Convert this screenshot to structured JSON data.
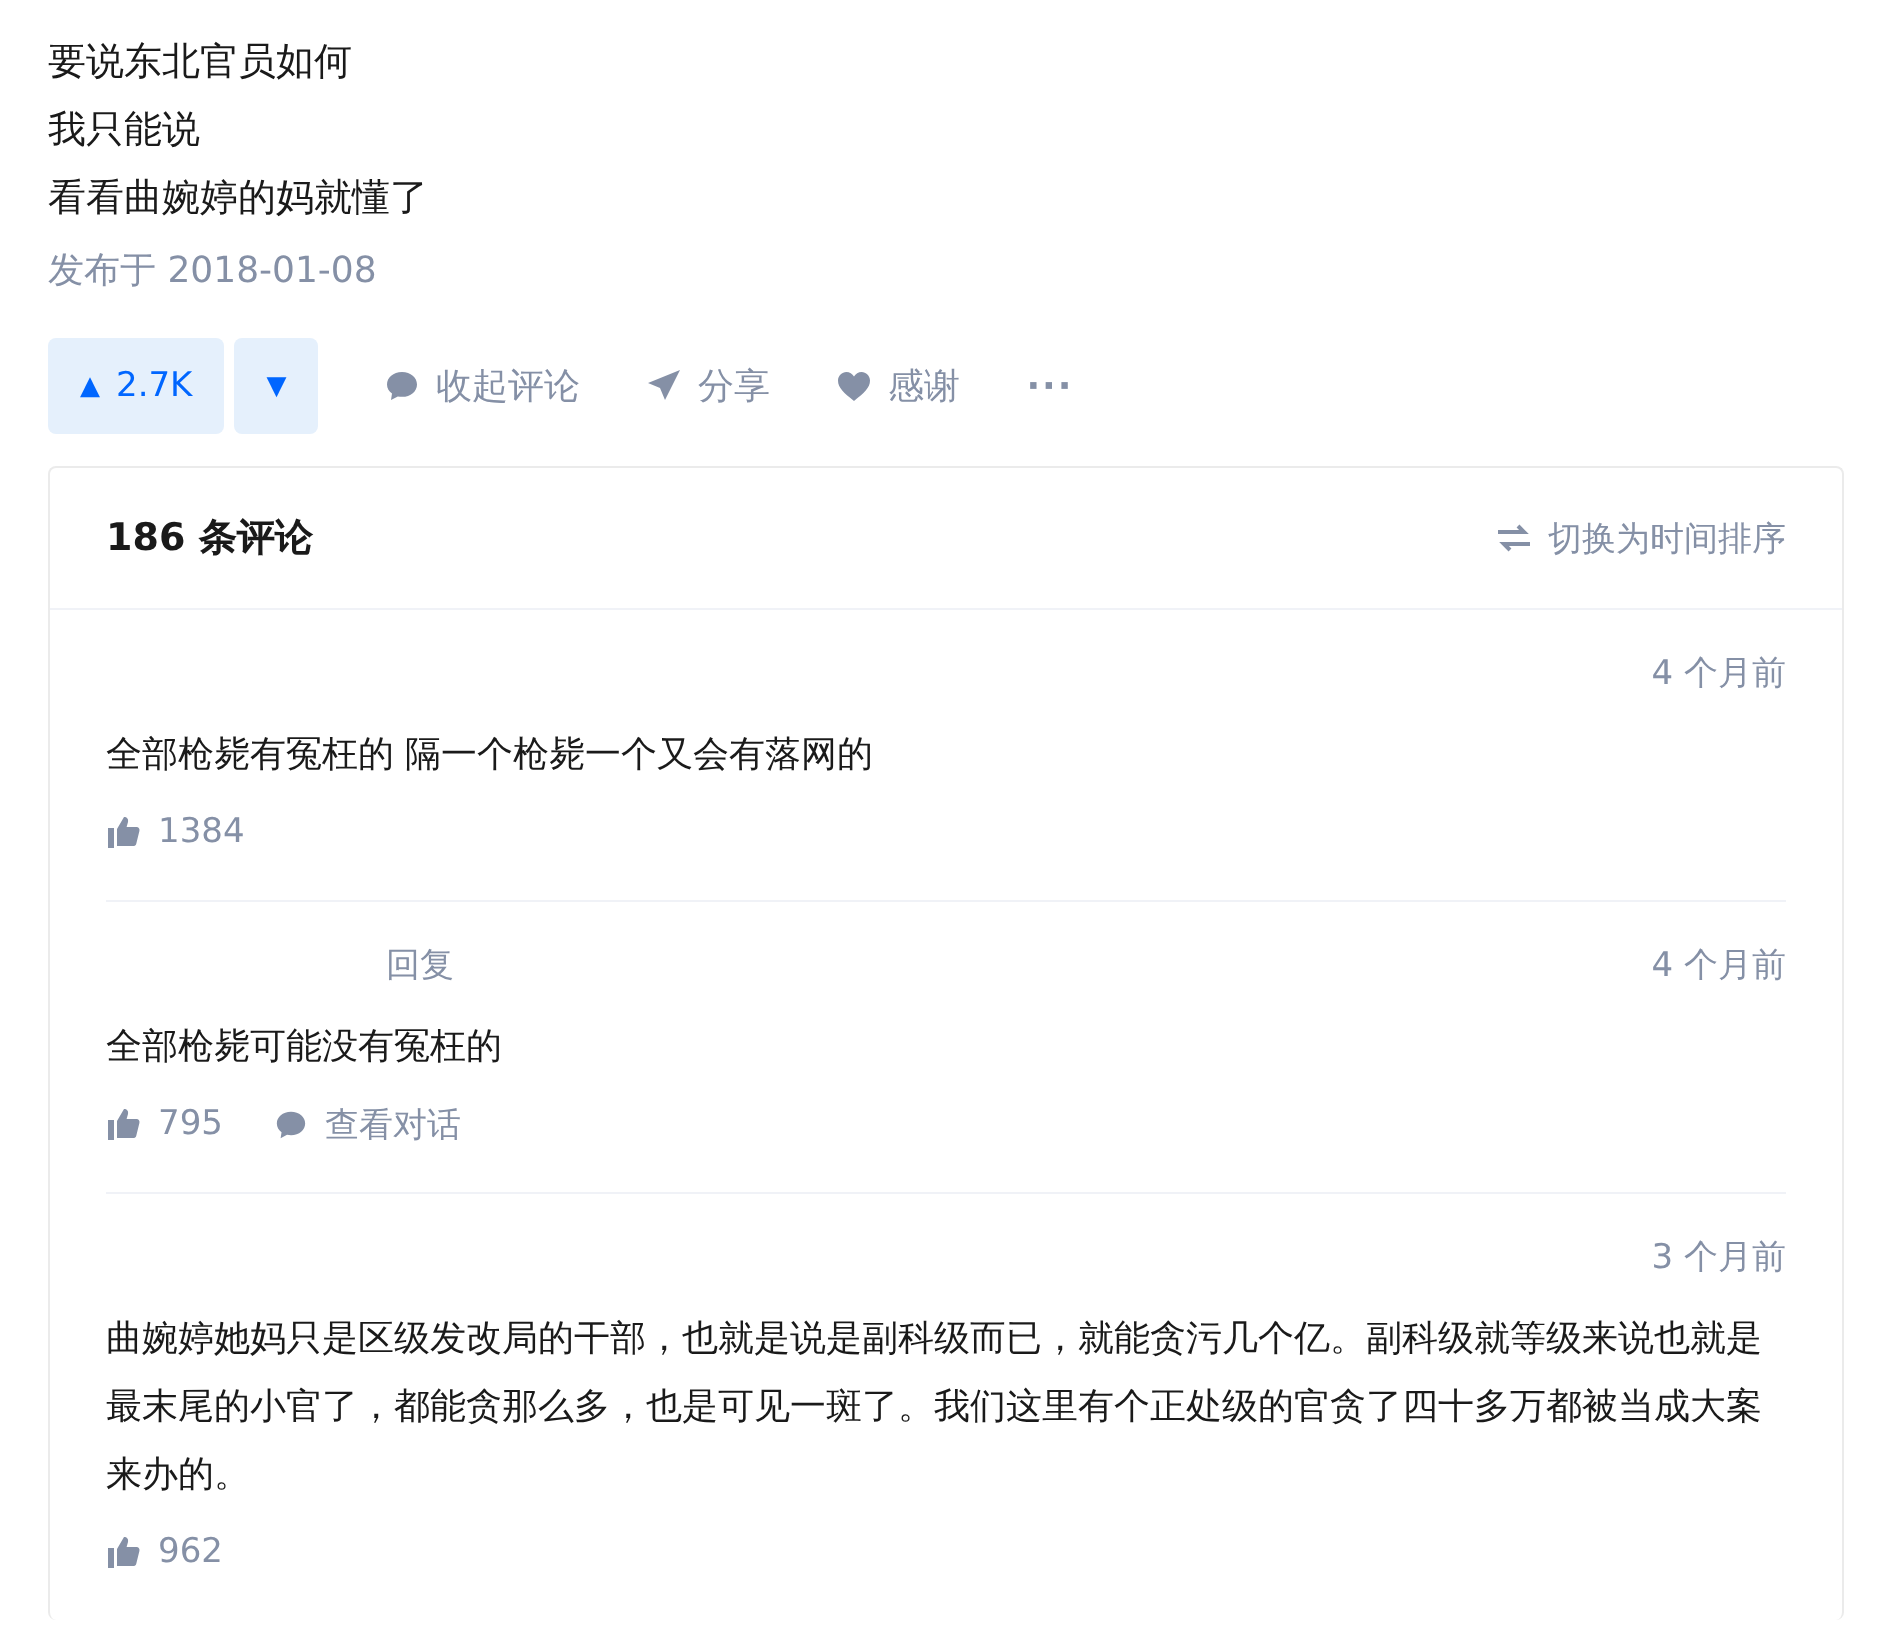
{
  "answer": {
    "lines": [
      "要说东北官员如何",
      "我只能说",
      "看看曲婉婷的妈就懂了"
    ],
    "published": "发布于 2018-01-08"
  },
  "actions": {
    "upvote": {
      "icon": "▲",
      "count": "2.7K"
    },
    "downvote": {
      "icon": "▼"
    },
    "items": [
      {
        "kind": "comment",
        "label": "收起评论"
      },
      {
        "kind": "share",
        "label": "分享"
      },
      {
        "kind": "thanks",
        "label": "感谢"
      },
      {
        "kind": "more",
        "label": "···"
      }
    ]
  },
  "comments": {
    "title": "186 条评论",
    "sort": "切换为时间排序",
    "items": [
      {
        "time": "4 个月前",
        "text": "全部枪毙有冤枉的 隔一个枪毙一个又会有落网的",
        "likes": "1384"
      },
      {
        "reply_label": "回复",
        "time": "4 个月前",
        "text": "全部枪毙可能没有冤枉的",
        "likes": "795",
        "link": "查看对话"
      },
      {
        "time": "3 个月前",
        "text": "曲婉婷她妈只是区级发改局的干部，也就是说是副科级而已，就能贪污几个亿。副科级就等级来说也就是最末尾的小官了，都能贪那么多，也是可见一斑了。我们这里有个正处级的官贪了四十多万都被当成大案来办的。",
        "likes": "962"
      }
    ]
  }
}
